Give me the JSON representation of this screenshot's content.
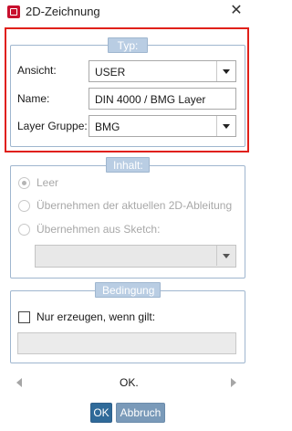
{
  "window": {
    "title": "2D-Zeichnung",
    "close_symbol": "✕",
    "icon": "app-icon"
  },
  "typ": {
    "title": "Typ:",
    "ansicht": {
      "label": "Ansicht:",
      "value": "USER"
    },
    "name": {
      "label": "Name:",
      "value": "DIN 4000 / BMG Layer"
    },
    "layer": {
      "label": "Layer Gruppe:",
      "value": "BMG"
    }
  },
  "inhalt": {
    "title": "Inhalt:",
    "options": [
      {
        "label": "Leer",
        "selected": true
      },
      {
        "label": "Übernehmen der aktuellen 2D-Ableitung",
        "selected": false
      },
      {
        "label": "Übernehmen aus Sketch:",
        "selected": false
      }
    ],
    "sketch_value": ""
  },
  "bedingung": {
    "title": "Bedingung",
    "checkbox_label": "Nur erzeugen, wenn gilt:",
    "checked": false,
    "expression": ""
  },
  "status": {
    "text": "OK."
  },
  "buttons": {
    "ok": "OK",
    "cancel": "Abbruch"
  },
  "colors": {
    "highlight": "#e0201a",
    "group_title_bg": "#b9cde3",
    "ok_button": "#2f6a99",
    "cancel_button": "#7a9ab9"
  }
}
